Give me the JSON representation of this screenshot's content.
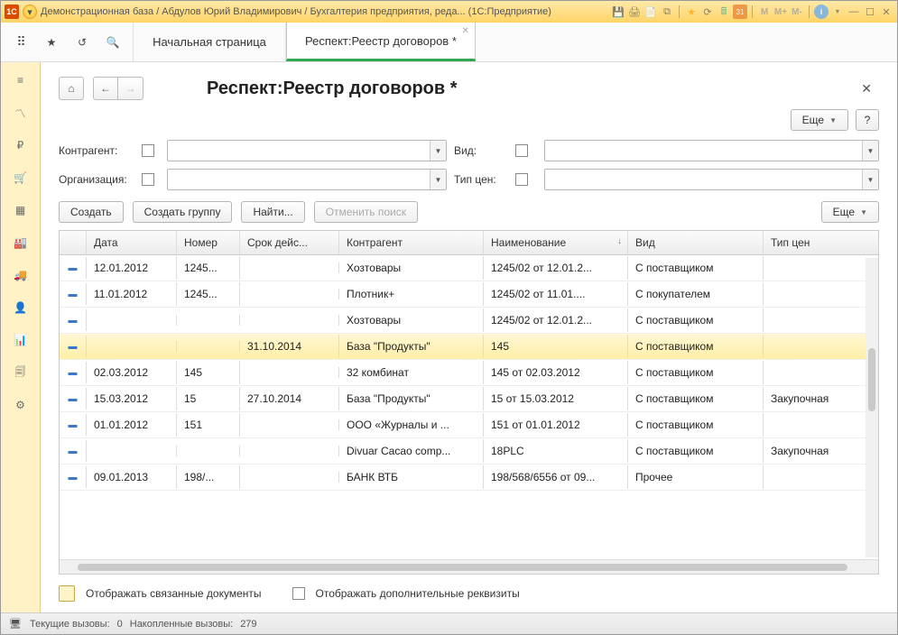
{
  "window": {
    "title": "Демонстрационная база / Абдулов Юрий Владимирович / Бухгалтерия предприятия, реда... (1С:Предприятие)"
  },
  "tabs": {
    "home": "Начальная страница",
    "active": "Респект:Реестр договоров *"
  },
  "page": {
    "title": "Респект:Реестр договоров *"
  },
  "buttons": {
    "more": "Еще",
    "help": "?",
    "create": "Создать",
    "create_group": "Создать группу",
    "find": "Найти...",
    "cancel_search": "Отменить поиск"
  },
  "filters": {
    "contractor_label": "Контрагент:",
    "org_label": "Организация:",
    "kind_label": "Вид:",
    "price_type_label": "Тип цен:"
  },
  "table": {
    "headers": {
      "date": "Дата",
      "number": "Номер",
      "validity": "Срок дейс...",
      "contractor": "Контрагент",
      "name": "Наименование",
      "kind": "Вид",
      "price_type": "Тип цен"
    },
    "rows": [
      {
        "date": "12.01.2012",
        "number": "1245...",
        "validity": "",
        "contractor": "Хозтовары",
        "name": "1245/02 от 12.01.2...",
        "kind": "С поставщиком",
        "price_type": ""
      },
      {
        "date": "11.01.2012",
        "number": "1245...",
        "validity": "",
        "contractor": "Плотник+",
        "name": "1245/02 от 11.01....",
        "kind": "С покупателем",
        "price_type": ""
      },
      {
        "date": "",
        "number": "",
        "validity": "",
        "contractor": "Хозтовары",
        "name": "1245/02 от 12.01.2...",
        "kind": "С поставщиком",
        "price_type": ""
      },
      {
        "date": "",
        "number": "",
        "validity": "31.10.2014",
        "contractor": "База \"Продукты\"",
        "name": "145",
        "kind": "С поставщиком",
        "price_type": "",
        "selected": true
      },
      {
        "date": "02.03.2012",
        "number": "145",
        "validity": "",
        "contractor": "32 комбинат",
        "name": "145 от 02.03.2012",
        "kind": "С поставщиком",
        "price_type": ""
      },
      {
        "date": "15.03.2012",
        "number": "15",
        "validity": "27.10.2014",
        "contractor": "База \"Продукты\"",
        "name": "15 от 15.03.2012",
        "kind": "С поставщиком",
        "price_type": "Закупочная"
      },
      {
        "date": "01.01.2012",
        "number": "151",
        "validity": "",
        "contractor": "ООО «Журналы и ...",
        "name": "151 от 01.01.2012",
        "kind": "С поставщиком",
        "price_type": ""
      },
      {
        "date": "",
        "number": "",
        "validity": "",
        "contractor": "Divuar Cacao comp...",
        "name": "18PLC",
        "kind": "С поставщиком",
        "price_type": "Закупочная"
      },
      {
        "date": "09.01.2013",
        "number": "198/...",
        "validity": "",
        "contractor": "БАНК ВТБ",
        "name": "198/568/6556 от 09...",
        "kind": "Прочее",
        "price_type": ""
      }
    ]
  },
  "footer": {
    "linked_docs": "Отображать связанные документы",
    "extra_props": "Отображать дополнительные реквизиты"
  },
  "statusbar": {
    "current_calls_lbl": "Текущие вызовы:",
    "current_calls_val": "0",
    "accum_calls_lbl": "Накопленные вызовы:",
    "accum_calls_val": "279"
  }
}
